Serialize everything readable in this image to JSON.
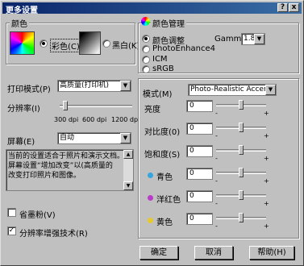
{
  "window": {
    "title": "更多设置"
  },
  "color_group": {
    "label": "颜色",
    "color_option": "彩色(C)",
    "bw_option": "黑白(K)"
  },
  "color_mgmt": {
    "label": "颜色管理",
    "options": [
      "颜色调整",
      "PhotoEnhance4",
      "ICM",
      "sRGB"
    ],
    "gamma_label": "Gamma",
    "gamma_value": "1.8"
  },
  "print_mode": {
    "label": "打印模式(P)",
    "value": "高质量(打印机)"
  },
  "resolution": {
    "label": "分辨率(I)",
    "ticks": [
      "300 dpi",
      "600 dpi",
      "1200 dpi"
    ],
    "value_fraction": 0.05
  },
  "screen": {
    "label": "屏幕(E)",
    "value": "自动"
  },
  "description": {
    "lines": [
      "当前的设置适合于照片和演示文档。",
      "屏幕设置“增加改变”以(高质量的",
      "改变打印照片和图像。"
    ]
  },
  "options": {
    "save_ink": "省墨粉(V)",
    "resolution_enhance": "分辨率增强技术(R)"
  },
  "adjust": {
    "mode_label": "模式(M)",
    "mode_value": "Photo-Realistic Accent",
    "rows": [
      {
        "label": "亮度",
        "value": "0",
        "dot": ""
      },
      {
        "label": "对比度(0)",
        "value": "0",
        "dot": ""
      },
      {
        "label": "饱和度(S)",
        "value": "0",
        "dot": ""
      },
      {
        "label": "青色",
        "value": "0",
        "dot": "#33a6e0"
      },
      {
        "label": "洋红色",
        "value": "0",
        "dot": "#b93cc9"
      },
      {
        "label": "黄色",
        "value": "0",
        "dot": "#e5c92e"
      }
    ],
    "minus": "-",
    "plus": "+"
  },
  "buttons": {
    "ok": "确定",
    "cancel": "取消",
    "help": "帮助(H)"
  },
  "title_buttons": {
    "help": "?",
    "close": "x"
  }
}
